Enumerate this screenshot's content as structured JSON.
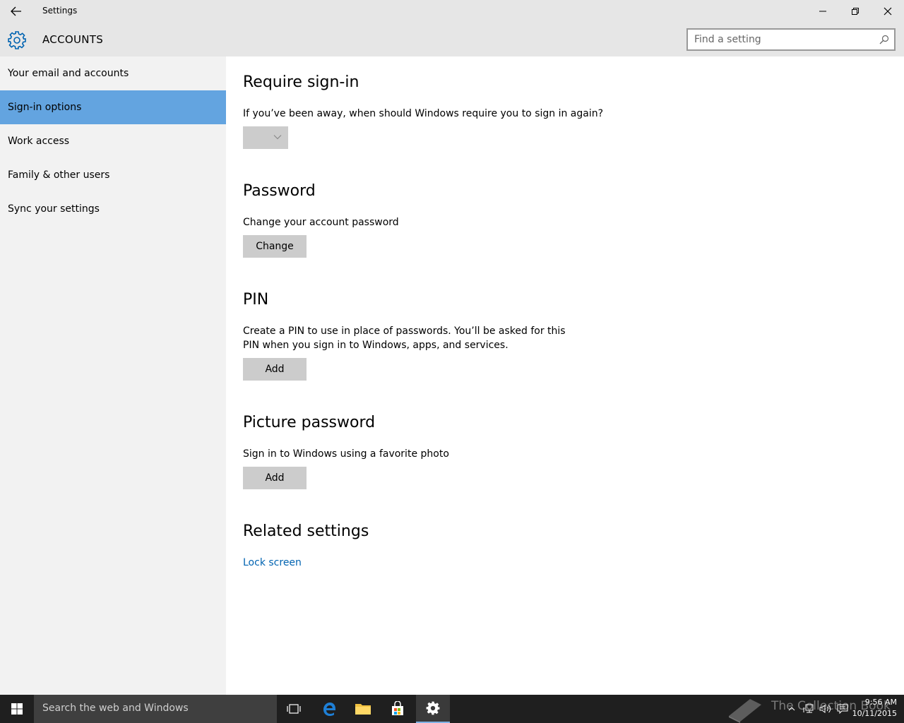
{
  "window": {
    "title": "Settings"
  },
  "header": {
    "section_title": "ACCOUNTS",
    "search_placeholder": "Find a setting"
  },
  "sidebar": {
    "items": [
      {
        "label": "Your email and accounts",
        "selected": false
      },
      {
        "label": "Sign-in options",
        "selected": true
      },
      {
        "label": "Work access",
        "selected": false
      },
      {
        "label": "Family & other users",
        "selected": false
      },
      {
        "label": "Sync your settings",
        "selected": false
      }
    ]
  },
  "content": {
    "require_signin": {
      "heading": "Require sign-in",
      "description": "If you’ve been away, when should Windows require you to sign in again?",
      "dropdown_value": ""
    },
    "password": {
      "heading": "Password",
      "description": "Change your account password",
      "button": "Change"
    },
    "pin": {
      "heading": "PIN",
      "description_line1": "Create a PIN to use in place of passwords. You’ll be asked for this",
      "description_line2": "PIN when you sign in to Windows, apps, and services.",
      "button": "Add"
    },
    "picture_password": {
      "heading": "Picture password",
      "description": "Sign in to Windows using a favorite photo",
      "button": "Add"
    },
    "related": {
      "heading": "Related settings",
      "link": "Lock screen"
    }
  },
  "taskbar": {
    "search_text": "Search the web and Windows",
    "watermark": "The Collection Book",
    "time": "9:56 AM",
    "date": "10/11/2015"
  },
  "colors": {
    "accent": "#63a4e0",
    "link": "#0063b1",
    "sidebar_bg": "#f2f2f2",
    "titlebar_bg": "#e6e6e6",
    "taskbar_bg": "#1f1f1f"
  }
}
